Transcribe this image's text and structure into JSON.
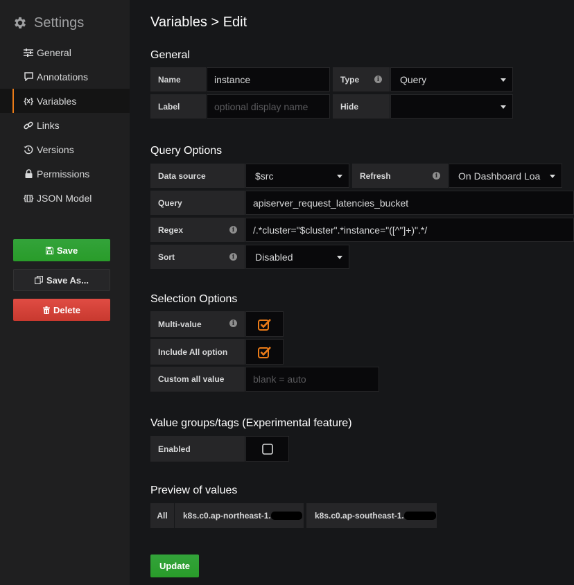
{
  "sidebar": {
    "title": "Settings",
    "items": [
      {
        "label": "General",
        "icon": "sliders-icon"
      },
      {
        "label": "Annotations",
        "icon": "comment-icon"
      },
      {
        "label": "Variables",
        "icon": "variable-icon",
        "icon_text": "{x}"
      },
      {
        "label": "Links",
        "icon": "link-icon"
      },
      {
        "label": "Versions",
        "icon": "history-icon"
      },
      {
        "label": "Permissions",
        "icon": "lock-icon"
      },
      {
        "label": "JSON Model",
        "icon": "json-icon",
        "icon_text": "{[]}"
      }
    ],
    "active_item": "Variables",
    "save_label": "Save",
    "save_as_label": "Save As...",
    "delete_label": "Delete"
  },
  "page": {
    "title": "Variables > Edit"
  },
  "general": {
    "heading": "General",
    "name_label": "Name",
    "name_value": "instance",
    "type_label": "Type",
    "type_value": "Query",
    "label_label": "Label",
    "label_placeholder": "optional display name",
    "hide_label": "Hide",
    "hide_value": ""
  },
  "query_options": {
    "heading": "Query Options",
    "datasource_label": "Data source",
    "datasource_value": "$src",
    "refresh_label": "Refresh",
    "refresh_value": "On Dashboard Loa",
    "query_label": "Query",
    "query_value": "apiserver_request_latencies_bucket",
    "regex_label": "Regex",
    "regex_value": "/.*cluster=\"$cluster\".*instance=\"([^\"]+)\".*/",
    "sort_label": "Sort",
    "sort_value": "Disabled"
  },
  "selection_options": {
    "heading": "Selection Options",
    "multi_value_label": "Multi-value",
    "multi_value_checked": true,
    "include_all_label": "Include All option",
    "include_all_checked": true,
    "custom_all_label": "Custom all value",
    "custom_all_placeholder": "blank = auto"
  },
  "value_groups": {
    "heading": "Value groups/tags (Experimental feature)",
    "enabled_label": "Enabled",
    "enabled_checked": false
  },
  "preview": {
    "heading": "Preview of values",
    "all_label": "All",
    "values": [
      "k8s.c0.ap-northeast-1.",
      "k8s.c0.ap-southeast-1."
    ]
  },
  "update_label": "Update",
  "colors": {
    "accent": "#eb7b18",
    "save": "#299c2a",
    "delete": "#d44a3a"
  }
}
